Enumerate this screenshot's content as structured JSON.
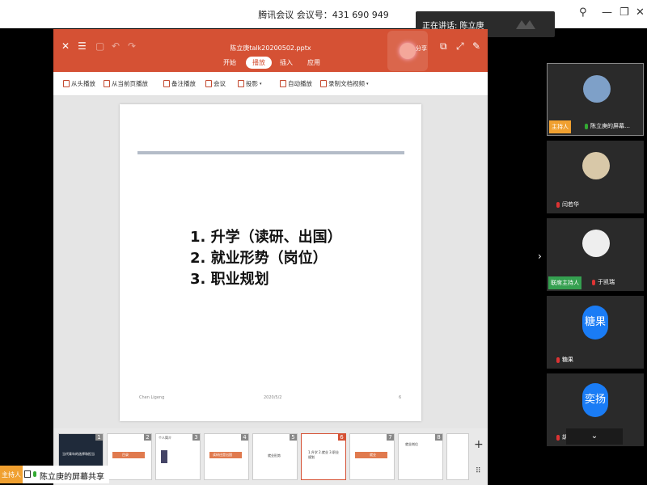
{
  "window": {
    "title": "腾讯会议 会议号：431 690 949",
    "controls": [
      "⚲",
      "—",
      "❐",
      "✕"
    ]
  },
  "speaking": {
    "label": "正在讲话: 陈立庚"
  },
  "presentation": {
    "doc_title": "陈立庚talk20200502.pptx",
    "tabs": [
      "开始",
      "播放",
      "插入",
      "应用"
    ],
    "active_tab": "播放",
    "share_label": "分享",
    "ribbon": [
      "从头播放",
      "从当前页播放",
      "备注播放",
      "会议",
      "投影",
      "自动播放",
      "录制文档视频"
    ],
    "slide": {
      "items": [
        "1.  升学（读研、出国）",
        "2.  就业形势（岗位）",
        "3.  职业规划"
      ],
      "footer_left": "Chen Ligeng",
      "footer_mid": "2020/5/2",
      "footer_right": "6"
    },
    "thumbnails": [
      {
        "num": "1",
        "caption": "当代青年的选择和担当"
      },
      {
        "num": "2",
        "caption": "目录"
      },
      {
        "num": "3",
        "caption": "个人简介"
      },
      {
        "num": "4",
        "caption": "读研还是出国"
      },
      {
        "num": "5",
        "caption": "就业形势"
      },
      {
        "num": "6",
        "caption": "1.升学 2.就业 3.职业规划"
      },
      {
        "num": "7",
        "caption": "就业"
      },
      {
        "num": "8",
        "caption": "就业岗位"
      }
    ],
    "add_slide": "+"
  },
  "participants": [
    {
      "name": "陈立庚的屏幕…",
      "badge": "主持人",
      "avatar": ""
    },
    {
      "name": "闫若华",
      "badge": "",
      "avatar": ""
    },
    {
      "name": "于凯瑞",
      "badge": "联席主持人",
      "avatar": ""
    },
    {
      "name": "糖果",
      "badge": "",
      "avatar": "糖果"
    },
    {
      "name": "胡奕扬",
      "badge": "",
      "avatar": "奕扬"
    }
  ],
  "share_bar": {
    "host_tag": "主持人",
    "text": "陈立庚的屏幕共享"
  },
  "colors": {
    "accent": "#d55134",
    "host": "#f0a030",
    "cohost": "#35a050",
    "avatar_blue": "#1a7cf5"
  }
}
